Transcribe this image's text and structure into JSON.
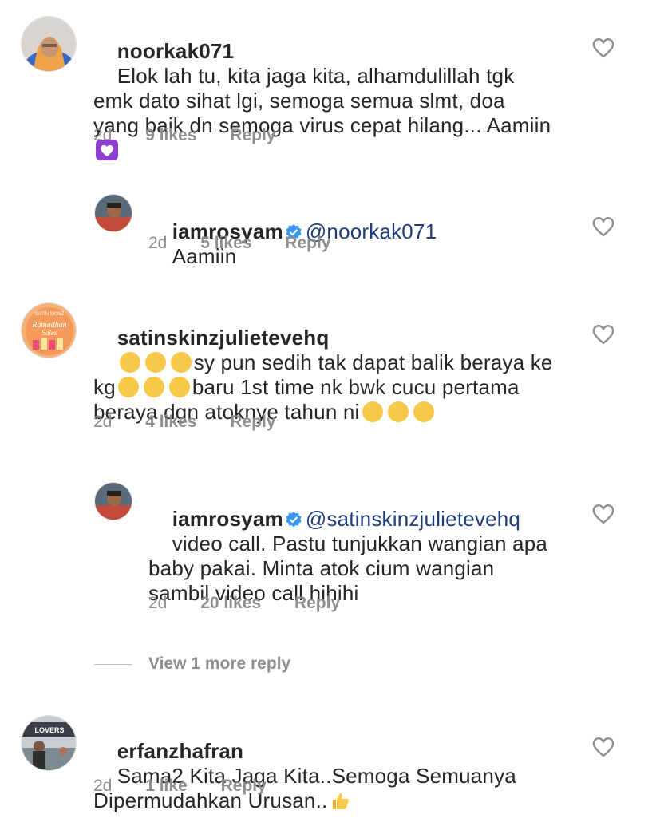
{
  "comments": [
    {
      "username": "noorkak071",
      "text": "Elok lah tu, kita jaga kita, alhamdulillah tgk emk dato sihat lgi, semoga semua slmt, doa yang baik dn semoga virus cepat hilang... Aamiin",
      "time": "2d",
      "likes": "9 likes",
      "reply": "Reply",
      "avatar_icon": "avatar-photo-hijab",
      "emoji_icon": "purple-heart-emoji"
    },
    {
      "username": "iamrosyam",
      "mention": "@noorkak071",
      "text": "Aamiin",
      "time": "2d",
      "likes": "5 likes",
      "reply": "Reply",
      "avatar_icon": "avatar-photo-man"
    },
    {
      "username": "satinskinzjulietevehq",
      "text_parts": [
        "sy pun sedih tak dapat balik beraya ke kg",
        "baru 1st time nk bwk cucu pertama beraya dgn atoknye tahun ni"
      ],
      "time": "2d",
      "likes": "4 likes",
      "reply": "Reply",
      "avatar_icon": "avatar-ramadhan-sales",
      "avatar_text": [
        "SATIN SKINZ",
        "Ramadhan",
        "Sales"
      ]
    },
    {
      "username": "iamrosyam",
      "mention": "@satinskinzjulietevehq",
      "text": "video call. Pastu tunjukkan wangian apa baby pakai. Minta atok cium wangian sambil video call hihihi",
      "time": "2d",
      "likes": "20 likes",
      "reply": "Reply",
      "avatar_icon": "avatar-photo-man"
    },
    {
      "username": "erfanzhafran",
      "text": "Sama2 Kita Jaga Kita..Semoga Semuanya Dipermudahkan Urusan..",
      "time": "2d",
      "likes": "1 like",
      "reply": "Reply",
      "avatar_icon": "avatar-photo-street",
      "avatar_text": "LOVERS",
      "emoji_icon": "thumbs-up-emoji"
    }
  ],
  "view_more": "View 1 more reply",
  "colors": {
    "mention": "#1f3d7a",
    "meta": "#8e8e8e",
    "verified": "#3897f0",
    "purple_heart": "#8e3fd0"
  }
}
